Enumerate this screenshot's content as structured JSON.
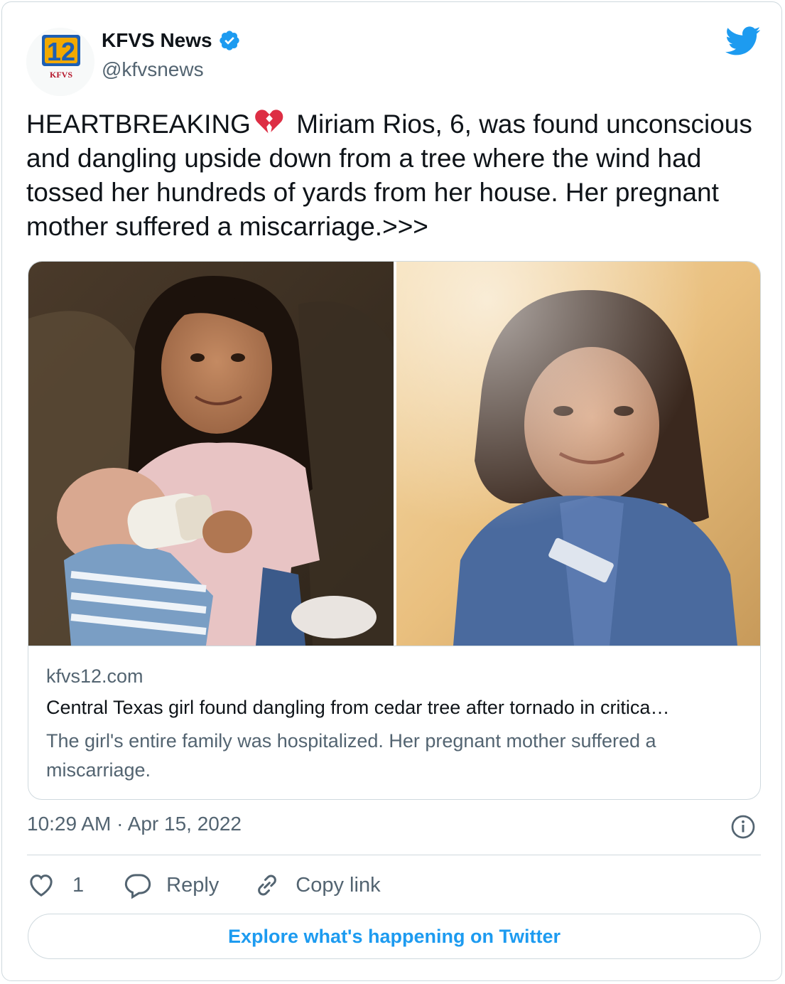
{
  "author": {
    "name": "KFVS News",
    "handle": "@kfvsnews",
    "verified": true,
    "logo_text": "12",
    "logo_subtext": "KFVS"
  },
  "tweet": {
    "text_before_emoji": "HEARTBREAKING",
    "emoji": "broken-heart",
    "text_after_emoji": " Miriam Rios, 6, was found unconscious and dangling upside down from a tree where the wind had tossed her hundreds of yards from her house. Her pregnant mother suffered a miscarriage.>>>"
  },
  "card": {
    "domain": "kfvs12.com",
    "title": "Central Texas girl found dangling from cedar tree after tornado in critica…",
    "description": "The girl's entire family was hospitalized. Her pregnant mother suffered a miscarriage."
  },
  "meta": {
    "timestamp": "10:29 AM · Apr 15, 2022"
  },
  "actions": {
    "like_count": "1",
    "reply_label": "Reply",
    "copy_link_label": "Copy link"
  },
  "explore_label": "Explore what's happening on Twitter",
  "colors": {
    "twitter_blue": "#1d9bf0",
    "secondary_text": "#536471",
    "border": "#cfd9de",
    "broken_heart": "#e0245e"
  },
  "icons": [
    "twitter-bird-icon",
    "verified-badge-icon",
    "broken-heart-emoji",
    "info-icon",
    "heart-icon",
    "reply-bubble-icon",
    "link-icon"
  ]
}
